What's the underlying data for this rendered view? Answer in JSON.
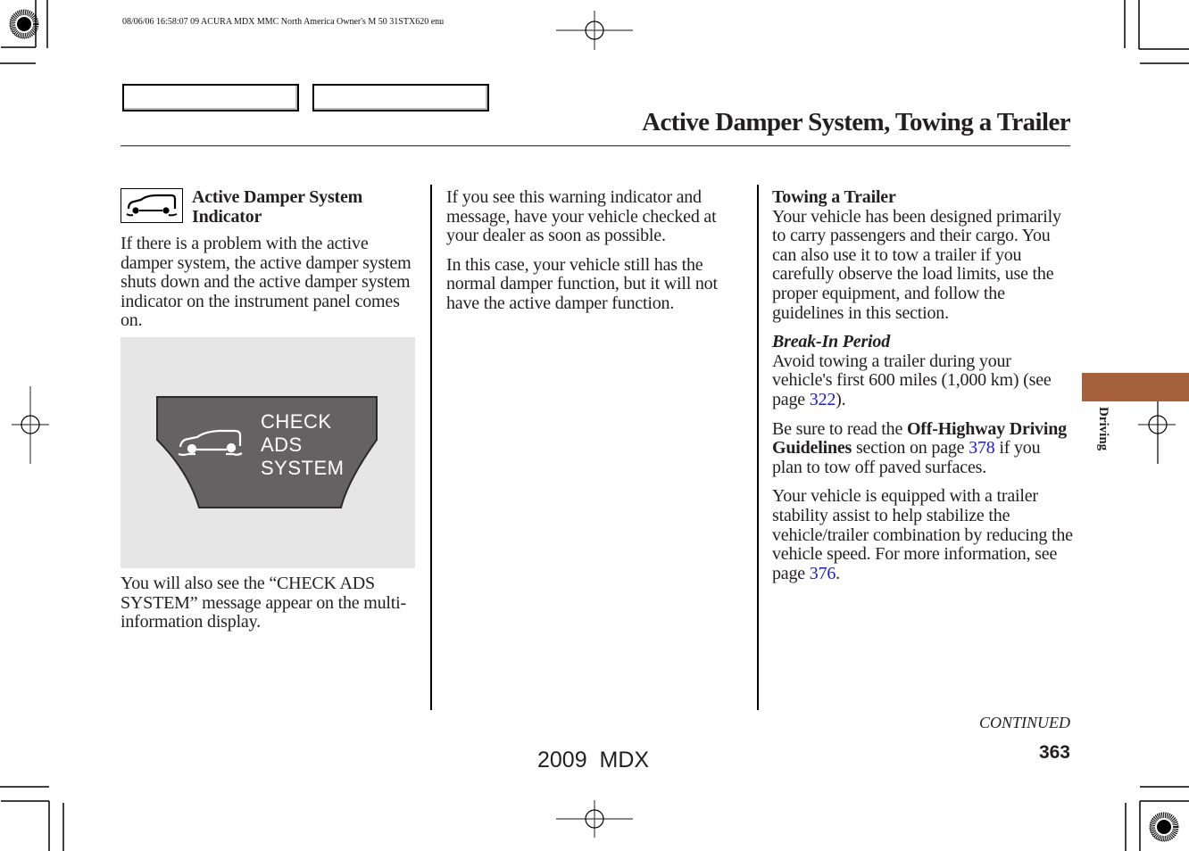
{
  "print_header": "08/06/06 16:58:07    09 ACURA MDX MMC North America Owner's M 50 31STX620 enu",
  "page_title": "Active Damper System, Towing a Trailer",
  "section_tab": {
    "label": "Driving",
    "color": "#a5613b"
  },
  "column1": {
    "indicator_icon": "active-damper-system-indicator",
    "heading": "Active Damper System Indicator",
    "paragraph1": "If there is a problem with the active damper system, the active damper system shuts down and the active damper system indicator on the instrument panel comes on.",
    "display": {
      "lines": [
        "CHECK",
        "ADS",
        "SYSTEM"
      ],
      "icon": "vehicle-suspension-icon"
    },
    "paragraph2": "You will also see the “CHECK ADS SYSTEM” message appear on the multi-information display."
  },
  "column2": {
    "paragraph1": "If you see this warning indicator and message, have your vehicle checked at your dealer as soon as possible.",
    "paragraph2": "In this case, your vehicle still has the normal damper function, but it will not have the active damper function."
  },
  "column3": {
    "heading": "Towing a Trailer",
    "paragraph1": "Your vehicle has been designed primarily to carry passengers and their cargo. You can also use it to tow a trailer if you carefully observe the load limits, use the proper equipment, and follow the guidelines in this section.",
    "subheading": "Break-In Period",
    "paragraph2_before": "Avoid towing a trailer during your vehicle's first 600 miles (1,000 km) (see page ",
    "paragraph2_link": "322",
    "paragraph2_after": ").",
    "paragraph3_before": "Be sure to read the ",
    "paragraph3_bold": "Off-Highway Driving Guidelines",
    "paragraph3_mid": " section on page ",
    "paragraph3_link": "378",
    "paragraph3_after": " if you plan to tow off paved surfaces.",
    "paragraph4_before": "Your vehicle is equipped with a trailer stability assist to help stabilize the vehicle/trailer combination by reducing the vehicle speed. For more information, see page ",
    "paragraph4_link": "376",
    "paragraph4_after": "."
  },
  "footer": {
    "continued": "CONTINUED",
    "page_number": "363",
    "model": "2009  MDX"
  },
  "colors": {
    "link": "#1a1adc",
    "display_panel": "#656263",
    "figure_background": "#e6e6e6"
  }
}
